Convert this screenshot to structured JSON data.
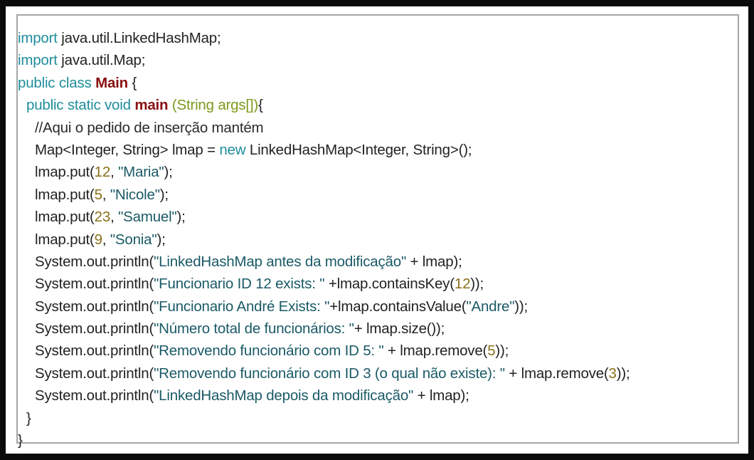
{
  "colors": {
    "keyword": "#1e8e9b",
    "class_name": "#8a1010",
    "type": "#7a9a1a",
    "string": "#1a5a66",
    "number": "#8a6f1a",
    "text": "#222222",
    "border": "#a6a6a6"
  },
  "code": {
    "lines": [
      [
        {
          "t": "kw",
          "v": "import"
        },
        {
          "t": "plain",
          "v": " java.util.LinkedHashMap;"
        }
      ],
      [
        {
          "t": "kw",
          "v": "import"
        },
        {
          "t": "plain",
          "v": " java.util.Map;"
        }
      ],
      [
        {
          "t": "kw",
          "v": "public class"
        },
        {
          "t": "plain",
          "v": " "
        },
        {
          "t": "cls",
          "v": "Main"
        },
        {
          "t": "plain",
          "v": " {"
        }
      ],
      [
        {
          "t": "kw",
          "v": "public static void"
        },
        {
          "t": "plain",
          "v": " "
        },
        {
          "t": "fn",
          "v": "main"
        },
        {
          "t": "plain",
          "v": " "
        },
        {
          "t": "ty",
          "v": "(String args[])"
        },
        {
          "t": "plain",
          "v": "{"
        }
      ],
      [
        {
          "t": "cmt",
          "v": "//Aqui o pedido de inserção mantém"
        }
      ],
      [
        {
          "t": "plain",
          "v": "Map<Integer, String> lmap = "
        },
        {
          "t": "kw",
          "v": "new"
        },
        {
          "t": "plain",
          "v": " LinkedHashMap<Integer, String>();"
        }
      ],
      [
        {
          "t": "plain",
          "v": "lmap.put("
        },
        {
          "t": "num",
          "v": "12"
        },
        {
          "t": "plain",
          "v": ", "
        },
        {
          "t": "str",
          "v": "\"Maria\""
        },
        {
          "t": "plain",
          "v": ");"
        }
      ],
      [
        {
          "t": "plain",
          "v": "lmap.put("
        },
        {
          "t": "num",
          "v": "5"
        },
        {
          "t": "plain",
          "v": ", "
        },
        {
          "t": "str",
          "v": "\"Nicole\""
        },
        {
          "t": "plain",
          "v": ");"
        }
      ],
      [
        {
          "t": "plain",
          "v": "lmap.put("
        },
        {
          "t": "num",
          "v": "23"
        },
        {
          "t": "plain",
          "v": ", "
        },
        {
          "t": "str",
          "v": "\"Samuel\""
        },
        {
          "t": "plain",
          "v": ");"
        }
      ],
      [
        {
          "t": "plain",
          "v": "lmap.put("
        },
        {
          "t": "num",
          "v": "9"
        },
        {
          "t": "plain",
          "v": ", "
        },
        {
          "t": "str",
          "v": "\"Sonia\""
        },
        {
          "t": "plain",
          "v": ");"
        }
      ],
      [
        {
          "t": "plain",
          "v": "System.out.println("
        },
        {
          "t": "str",
          "v": "\"LinkedHashMap antes da modificação\""
        },
        {
          "t": "plain",
          "v": " + lmap);"
        }
      ],
      [
        {
          "t": "plain",
          "v": "System.out.println("
        },
        {
          "t": "str",
          "v": "\"Funcionario ID 12 exists: \""
        },
        {
          "t": "plain",
          "v": " +lmap.containsKey("
        },
        {
          "t": "num",
          "v": "12"
        },
        {
          "t": "plain",
          "v": "));"
        }
      ],
      [
        {
          "t": "plain",
          "v": "System.out.println("
        },
        {
          "t": "str",
          "v": "\"Funcionario André Exists: \""
        },
        {
          "t": "plain",
          "v": "+lmap.containsValue("
        },
        {
          "t": "str",
          "v": "\"Andre\""
        },
        {
          "t": "plain",
          "v": "));"
        }
      ],
      [
        {
          "t": "plain",
          "v": "System.out.println("
        },
        {
          "t": "str",
          "v": "\"Número total de funcionários: \""
        },
        {
          "t": "plain",
          "v": "+ lmap.size());"
        }
      ],
      [
        {
          "t": "plain",
          "v": "System.out.println("
        },
        {
          "t": "str",
          "v": "\"Removendo funcionário com ID 5: \""
        },
        {
          "t": "plain",
          "v": " + lmap.remove("
        },
        {
          "t": "num",
          "v": "5"
        },
        {
          "t": "plain",
          "v": "));"
        }
      ],
      [
        {
          "t": "plain",
          "v": "System.out.println("
        },
        {
          "t": "str",
          "v": "\"Removendo funcionário com ID 3 (o qual não existe): \""
        },
        {
          "t": "plain",
          "v": " + lmap.remove("
        },
        {
          "t": "num",
          "v": "3"
        },
        {
          "t": "plain",
          "v": "));"
        }
      ],
      [
        {
          "t": "plain",
          "v": "System.out.println("
        },
        {
          "t": "str",
          "v": "\"LinkedHashMap depois da modificação\""
        },
        {
          "t": "plain",
          "v": " + lmap);"
        }
      ],
      [
        {
          "t": "plain",
          "v": "}"
        }
      ],
      [
        {
          "t": "plain",
          "v": "}"
        }
      ]
    ]
  }
}
